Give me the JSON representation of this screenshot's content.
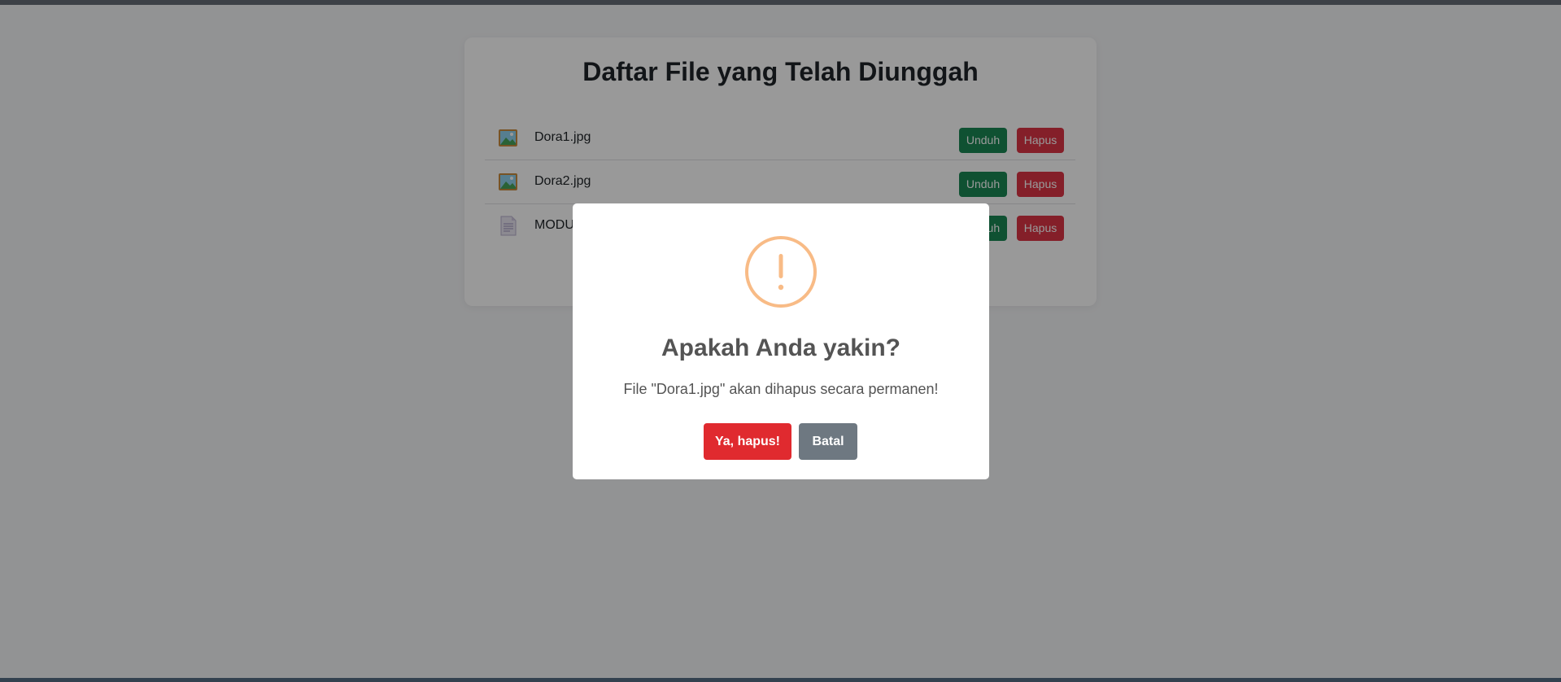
{
  "page": {
    "title": "Daftar File yang Telah Diunggah",
    "files": [
      {
        "name": "Dora1.jpg",
        "icon": "image-file-icon",
        "download_label": "Unduh",
        "delete_label": "Hapus"
      },
      {
        "name": "Dora2.jpg",
        "icon": "image-file-icon",
        "download_label": "Unduh",
        "delete_label": "Hapus"
      },
      {
        "name": "MODU",
        "icon": "document-file-icon",
        "download_label": "Unduh",
        "delete_label": "Hapus"
      }
    ]
  },
  "dialog": {
    "icon": "warning-icon",
    "title": "Apakah Anda yakin?",
    "text": "File \"Dora1.jpg\" akan dihapus secara permanen!",
    "confirm_label": "Ya, hapus!",
    "cancel_label": "Batal"
  },
  "colors": {
    "download_button": "#198754",
    "delete_button": "#dc3545",
    "confirm_button": "#e02a2f",
    "cancel_button": "#6e7881",
    "warning": "#f8bb86"
  }
}
